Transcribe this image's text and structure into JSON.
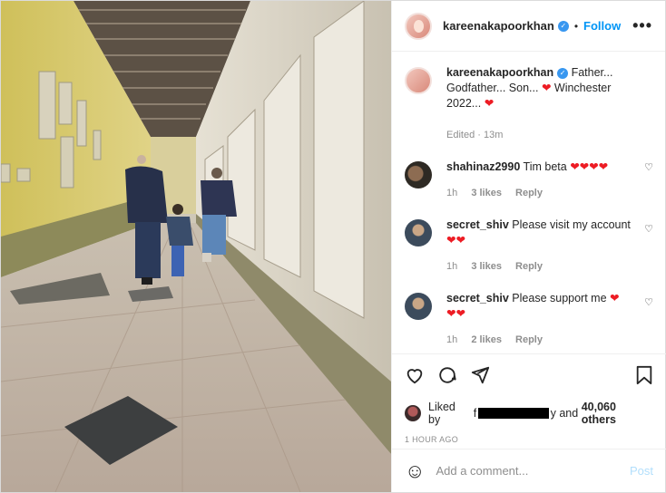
{
  "post": {
    "username": "kareenakapoorkhan",
    "separator": "•",
    "follow_label": "Follow",
    "more_label": "•••"
  },
  "caption": {
    "username": "kareenakapoorkhan",
    "text_1": "Father... Godfather... Son...",
    "text_2": "Winchester 2022...",
    "edited": "Edited · 13m"
  },
  "comments": [
    {
      "username": "shahinaz2990",
      "text": "Tim beta",
      "hearts": "❤❤❤❤",
      "time": "1h",
      "likes": "3 likes",
      "reply": "Reply"
    },
    {
      "username": "secret_shiv",
      "text": "Please visit my account",
      "hearts": "❤❤",
      "time": "1h",
      "likes": "3 likes",
      "reply": "Reply"
    },
    {
      "username": "secret_shiv",
      "text": "Please support me",
      "hearts": "❤",
      "hearts2": "❤❤",
      "time": "1h",
      "likes": "2 likes",
      "reply": "Reply"
    }
  ],
  "likes": {
    "prefix": "Liked by",
    "name_partial_1": "f",
    "name_partial_2": "y",
    "suffix": "and",
    "others": "40,060 others"
  },
  "time_ago": "1 HOUR AGO",
  "comment_box": {
    "placeholder": "Add a comment...",
    "post_label": "Post"
  },
  "colors": {
    "accent": "#0095f6",
    "heart": "#ed1c24",
    "muted": "#8e8e8e"
  }
}
